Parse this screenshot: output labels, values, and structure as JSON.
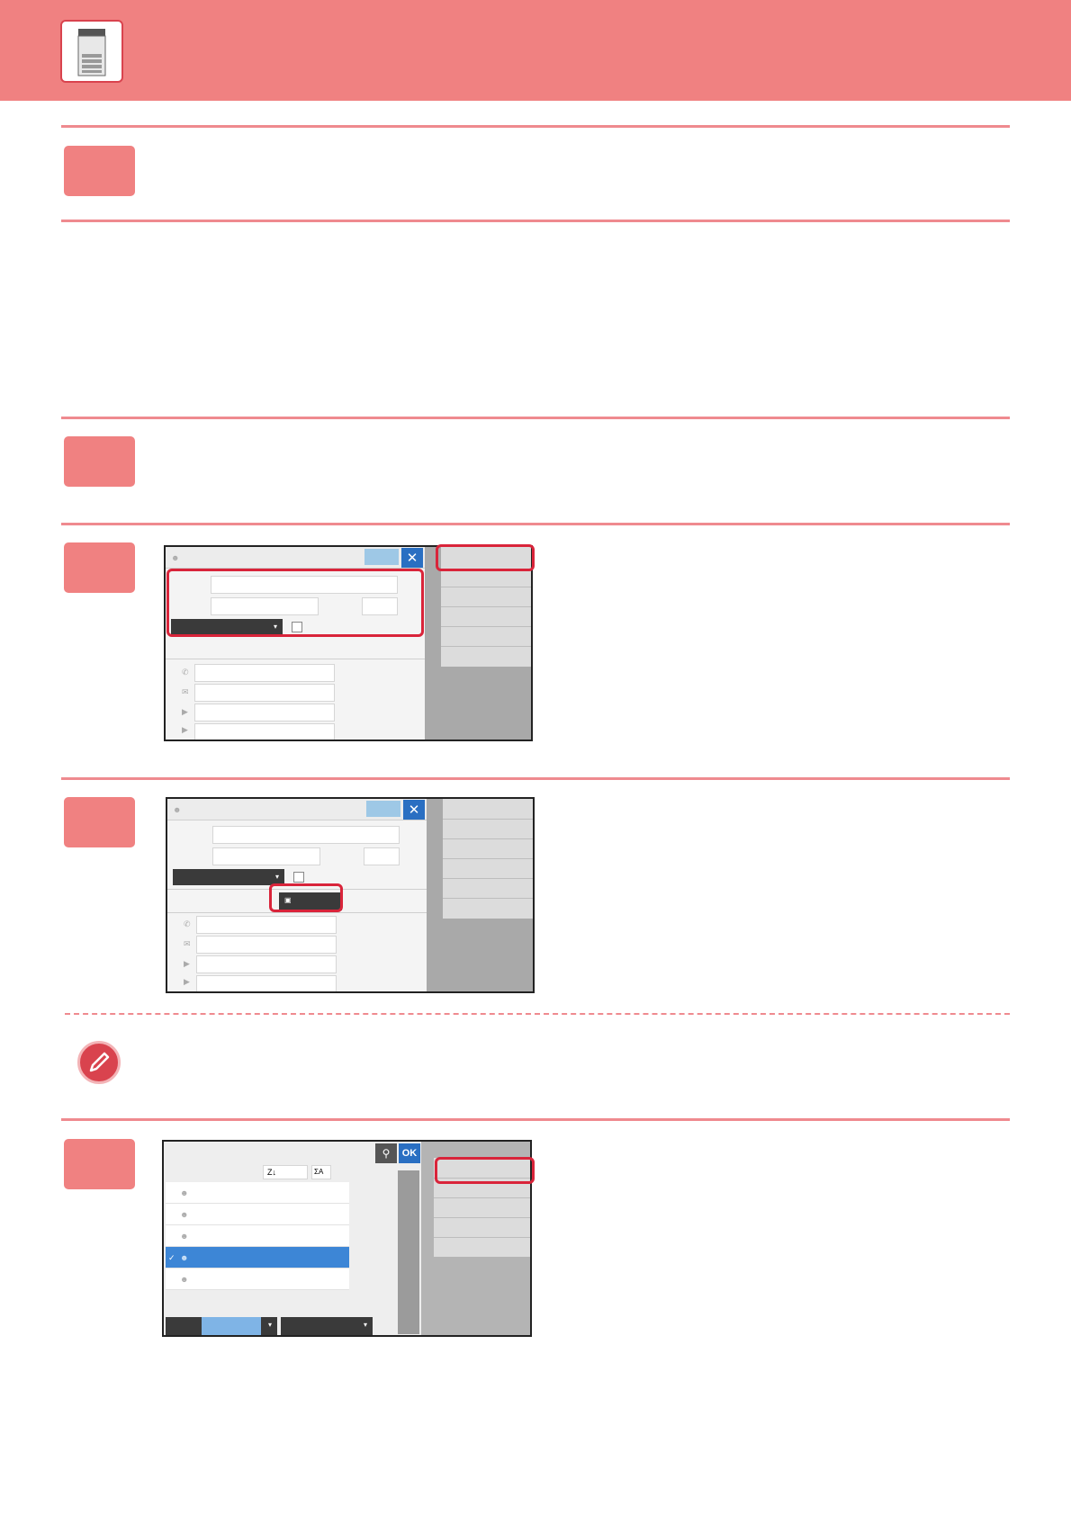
{
  "icons": {
    "header": "printer-icon",
    "note": "pencil-icon",
    "close": "close-icon",
    "search": "magnifier-icon",
    "contact": "person-icon",
    "group": "group-icon"
  },
  "screens": {
    "close_symbol": "✕",
    "ok_label": "OK",
    "sort_az": "Z↓",
    "sort_label": "ΣA"
  },
  "colors": {
    "header": "#f08181",
    "accent": "#d9243a",
    "select_blue": "#3d86d6"
  }
}
